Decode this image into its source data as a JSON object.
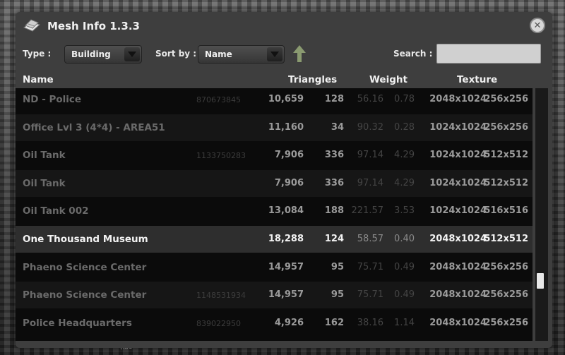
{
  "window": {
    "title": "Mesh Info 1.3.3",
    "icon": "building-icon",
    "close_icon": "close-icon"
  },
  "filters": {
    "type_label": "Type :",
    "type_value": "Building",
    "sort_label": "Sort by :",
    "sort_value": "Name",
    "sort_direction_icon": "arrow-up-icon",
    "search_label": "Search :",
    "search_value": "",
    "search_placeholder": ""
  },
  "table": {
    "headers": {
      "name": "Name",
      "triangles": "Triangles",
      "weight": "Weight",
      "texture": "Texture"
    },
    "rows": [
      {
        "name": "ND - Police",
        "id": "870673845",
        "triangles": "10,659",
        "count": "128",
        "weight1": "56.16",
        "weight2": "0.78",
        "tex1": "2048x1024",
        "tex2": "256x256"
      },
      {
        "name": "Office Lvl 3 (4*4) - AREA51",
        "id": "",
        "triangles": "11,160",
        "count": "34",
        "weight1": "90.32",
        "weight2": "0.28",
        "tex1": "1024x1024",
        "tex2": "256x256"
      },
      {
        "name": "Oil Tank",
        "id": "1133750283",
        "triangles": "7,906",
        "count": "336",
        "weight1": "97.14",
        "weight2": "4.29",
        "tex1": "1024x1024",
        "tex2": "512x512"
      },
      {
        "name": "Oil Tank",
        "id": "",
        "triangles": "7,906",
        "count": "336",
        "weight1": "97.14",
        "weight2": "4.29",
        "tex1": "1024x1024",
        "tex2": "512x512"
      },
      {
        "name": "Oil Tank 002",
        "id": "",
        "triangles": "13,084",
        "count": "188",
        "weight1": "221.57",
        "weight2": "3.53",
        "tex1": "1024x1024",
        "tex2": "516x516"
      },
      {
        "name": "One Thousand Museum",
        "id": "",
        "triangles": "18,288",
        "count": "124",
        "weight1": "58.57",
        "weight2": "0.40",
        "tex1": "2048x1024",
        "tex2": "512x512"
      },
      {
        "name": "Phaeno Science Center",
        "id": "",
        "triangles": "14,957",
        "count": "95",
        "weight1": "75.71",
        "weight2": "0.49",
        "tex1": "2048x1024",
        "tex2": "256x256"
      },
      {
        "name": "Phaeno Science Center",
        "id": "1148531934",
        "triangles": "14,957",
        "count": "95",
        "weight1": "75.71",
        "weight2": "0.49",
        "tex1": "2048x1024",
        "tex2": "256x256"
      },
      {
        "name": "Police Headquarters",
        "id": "839022950",
        "triangles": "4,926",
        "count": "162",
        "weight1": "38.16",
        "weight2": "1.14",
        "tex1": "2048x1024",
        "tex2": "256x256"
      }
    ],
    "selected_index": 5
  },
  "scrollbar": {
    "position_fraction": 0.78
  },
  "background": {
    "street_label": "Rue Houx"
  },
  "colors": {
    "panel_bg": "#3e3e3e",
    "list_bg": "#0b0b0b",
    "selected_row": "#2e2e2e",
    "accent_arrow": "#8a9a70"
  }
}
